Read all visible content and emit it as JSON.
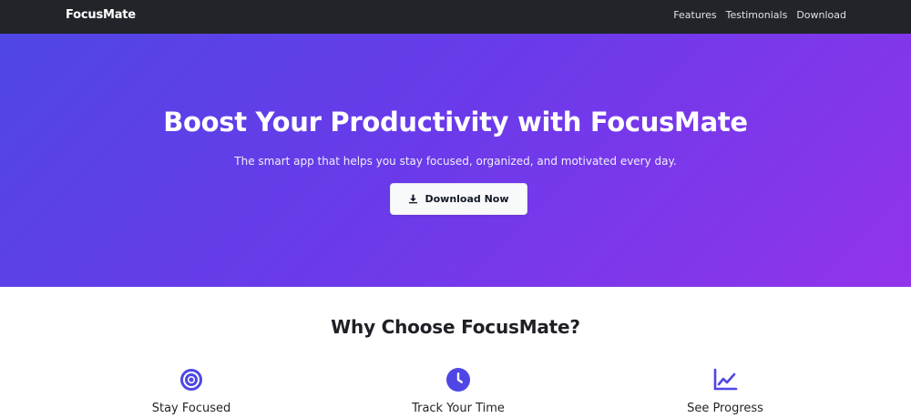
{
  "navbar": {
    "brand": "FocusMate",
    "links": [
      "Features",
      "Testimonials",
      "Download"
    ]
  },
  "hero": {
    "title": "Boost Your Productivity with FocusMate",
    "subtitle": "The smart app that helps you stay focused, organized, and motivated every day.",
    "cta_label": "Download Now",
    "cta_icon": "download-icon"
  },
  "features": {
    "title": "Why Choose FocusMate?",
    "items": [
      {
        "label": "Stay Focused",
        "icon": "target-icon"
      },
      {
        "label": "Track Your Time",
        "icon": "clock-icon"
      },
      {
        "label": "See Progress",
        "icon": "chart-line-icon"
      }
    ]
  },
  "colors": {
    "navbar_bg": "#212529",
    "hero_gradient_start": "#4f46e5",
    "hero_gradient_end": "#9234ea",
    "icon_accent": "#4f46e5",
    "button_bg": "#f8f9fa"
  }
}
